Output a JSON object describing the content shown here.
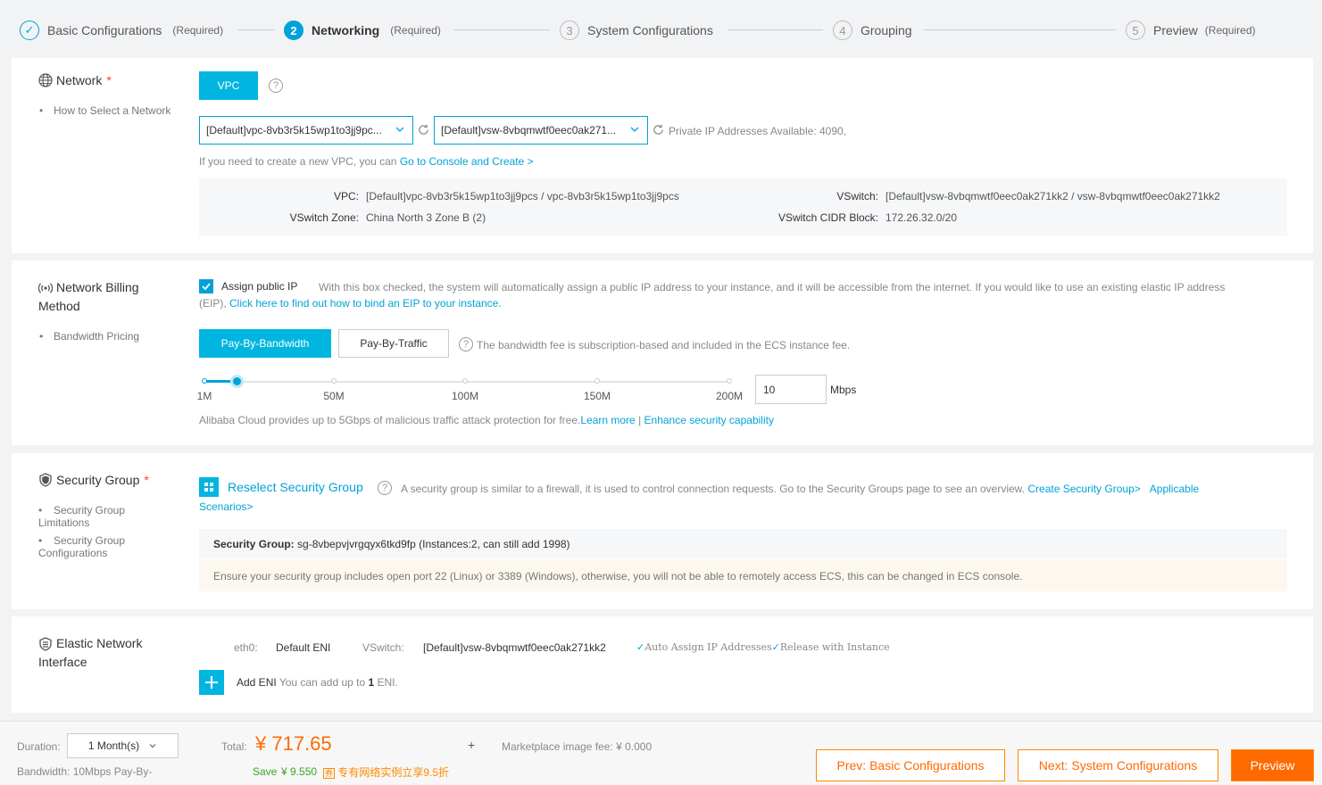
{
  "steps": [
    {
      "num": "✓",
      "label": "Basic Configurations",
      "req": "(Required)"
    },
    {
      "num": "2",
      "label": "Networking",
      "req": "(Required)"
    },
    {
      "num": "3",
      "label": "System Configurations",
      "req": ""
    },
    {
      "num": "4",
      "label": "Grouping",
      "req": ""
    },
    {
      "num": "5",
      "label": "Preview",
      "req": "(Required)"
    }
  ],
  "network": {
    "title": "Network",
    "required_mark": "*",
    "help_link": "How to Select a Network",
    "vpc_button": "VPC",
    "help_q": "?",
    "vpc_select": "[Default]vpc-8vb3r5k15wp1to3jj9pc...",
    "vsw_select": "[Default]vsw-8vbqmwtf0eec0ak271...",
    "private_ip": "Private IP Addresses Available: 4090,",
    "create_hint": "If you need to create a new VPC, you can",
    "create_link": "Go to Console and Create >",
    "info": {
      "vpc_label": "VPC:",
      "vpc_value": "[Default]vpc-8vb3r5k15wp1to3jj9pcs / vpc-8vb3r5k15wp1to3jj9pcs",
      "vswitch_label": "VSwitch:",
      "vswitch_value": "[Default]vsw-8vbqmwtf0eec0ak271kk2 / vsw-8vbqmwtf0eec0ak271kk2",
      "zone_label": "VSwitch Zone:",
      "zone_value": "China North 3 Zone B (2)",
      "cidr_label": "VSwitch CIDR Block:",
      "cidr_value": "172.26.32.0/20"
    }
  },
  "billing": {
    "title_line1": "Network Billing",
    "title_line2": "Method",
    "side": "Bandwidth Pricing",
    "assign_label": "Assign public IP",
    "assign_checked": true,
    "assign_desc": "With this box checked, the system will automatically assign a public IP address to your instance, and it will be accessible from the internet. If you would like to use an existing elastic IP address",
    "assign_desc2": "(EIP),",
    "eip_link": "Click here to find out how to bind an EIP to your instance.",
    "pay_bandwidth": "Pay-By-Bandwidth",
    "pay_traffic": "Pay-By-Traffic",
    "fee_note": "The bandwidth fee is subscription-based and included in the ECS instance fee.",
    "slider_ticks": [
      "1M",
      "50M",
      "100M",
      "150M",
      "200M"
    ],
    "bandwidth_value": "10",
    "unit": "Mbps",
    "protection": "Alibaba Cloud provides up to 5Gbps of malicious traffic attack protection for free.",
    "learn_more": "Learn more",
    "sep": "|",
    "enhance": "Enhance security capability"
  },
  "security": {
    "title": "Security Group",
    "required_mark": "*",
    "side1": "Security Group",
    "side1b": "Limitations",
    "side2": "Security Group",
    "side2b": "Configurations",
    "reselect": "Reselect Security Group",
    "desc": "A security group is similar to a firewall, it is used to control connection requests. Go to the Security Groups page to see an overview.",
    "create_link": "Create Security Group>",
    "applicable": "Applicable",
    "scenarios": "Scenarios>",
    "sg_label": "Security Group:",
    "sg_value": "sg-8vbepvjvrgqyx6tkd9fp",
    "sg_instances": "(Instances:2, can still add 1998)",
    "warning": "Ensure your security group includes open port 22 (Linux) or 3389 (Windows), otherwise, you will not be able to remotely access ECS, this can be changed in ECS console."
  },
  "eni": {
    "title_line1": "Elastic Network",
    "title_line2": "Interface",
    "eth0": "eth0:",
    "default_eni": "Default ENI",
    "vswitch_label": "VSwitch:",
    "vswitch_value": "[Default]vsw-8vbqmwtf0eec0ak271kk2",
    "auto_assign": "Auto Assign IP Addresses",
    "release": "Release with Instance",
    "add_eni": "Add ENI",
    "add_hint_pre": "You can add up to",
    "add_count": "1",
    "add_hint_post": "ENI."
  },
  "footer": {
    "duration_label": "Duration:",
    "duration_value": "1 Month(s)",
    "bandwidth": "Bandwidth: 10Mbps Pay-By-",
    "total_label": "Total:",
    "total_value": "¥ 717.65",
    "plus": "+",
    "market_label": "Marketplace image fee:",
    "market_value": "¥ 0.000",
    "save_label": "Save",
    "save_value": "¥ 9.550",
    "promo": "专有网络实例立享9.5折",
    "prev_button": "Prev: Basic Configurations",
    "next_button": "Next: System Configurations",
    "preview_button": "Preview"
  },
  "colors": {
    "accent": "#00a2d8",
    "orange": "#ff6a00",
    "required": "#ff3b30",
    "green": "#3ca32a"
  }
}
